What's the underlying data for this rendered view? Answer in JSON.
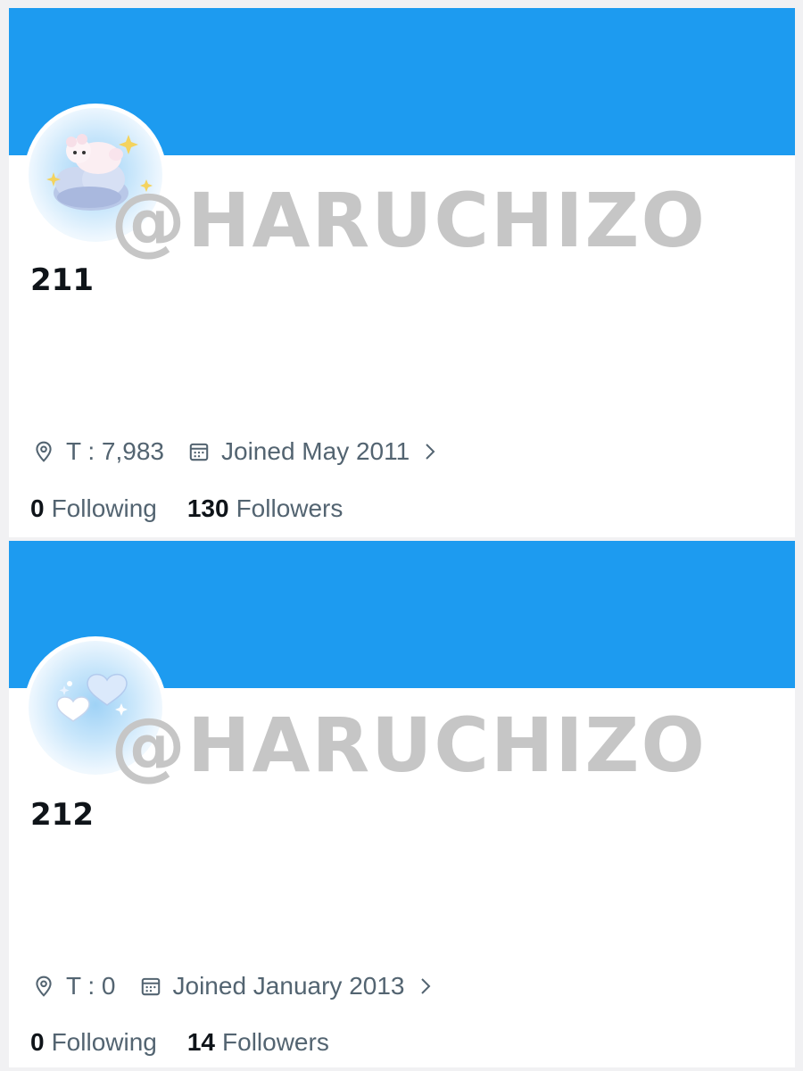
{
  "colors": {
    "banner": "#1d9bf0",
    "text_primary": "#0f1419",
    "text_secondary": "#536471",
    "watermark": "#c6c6c6"
  },
  "profiles": [
    {
      "watermark": "@HARUCHIZO",
      "display_name": "211",
      "location": "T : 7,983",
      "joined": "Joined May 2011",
      "following_count": "0",
      "following_label": "Following",
      "followers_count": "130",
      "followers_label": "Followers",
      "avatar_icon": "cloud-lamb-icon"
    },
    {
      "watermark": "@HARUCHIZO",
      "display_name": "212",
      "location": "T : 0",
      "joined": "Joined January 2013",
      "following_count": "0",
      "following_label": "Following",
      "followers_count": "14",
      "followers_label": "Followers",
      "avatar_icon": "hearts-icon"
    }
  ]
}
